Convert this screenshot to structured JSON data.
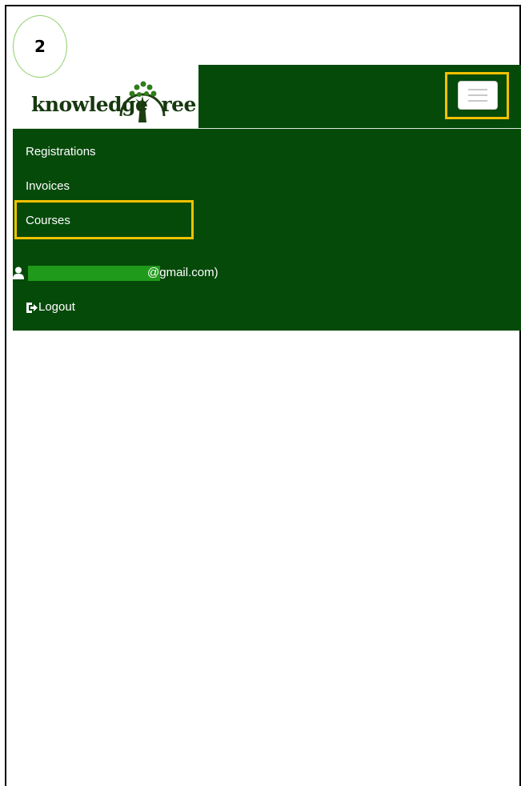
{
  "annotation": {
    "step_number": "2"
  },
  "brand": {
    "logo_text": "knowledge",
    "logo_text_tail": "ree",
    "logo_full_name": "knowledgeTree"
  },
  "navbar": {
    "toggle_icon": "hamburger-menu-icon",
    "menu_items": [
      {
        "label": "Registrations"
      },
      {
        "label": "Invoices"
      },
      {
        "label": "Courses"
      }
    ],
    "user": {
      "icon": "user-icon",
      "email_suffix": "@gmail.com)"
    },
    "logout": {
      "icon": "sign-out-icon",
      "label": "Logout"
    }
  },
  "colors": {
    "navbar_bg": "#064a0a",
    "highlight": "#f2c100",
    "redaction": "#1f9a1a",
    "text": "#ffffff"
  }
}
